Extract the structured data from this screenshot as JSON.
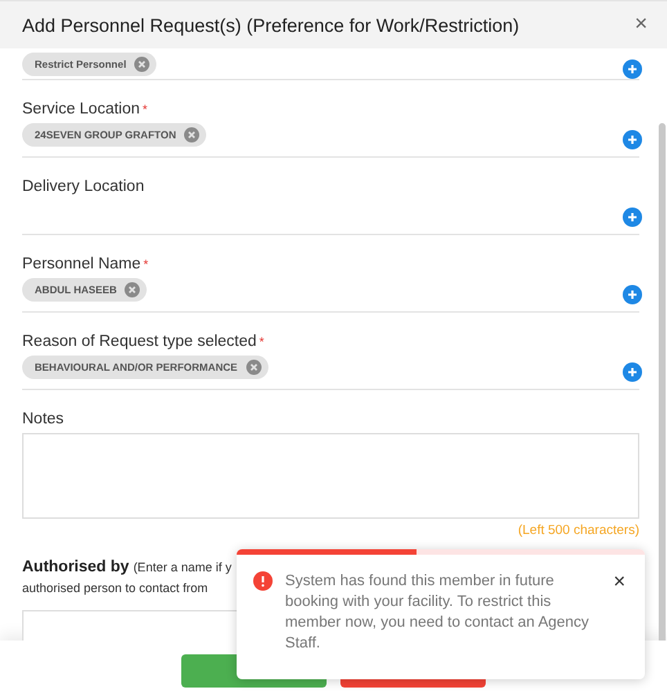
{
  "dialog": {
    "title": "Add Personnel Request(s) (Preference for Work/Restriction)",
    "close": "×"
  },
  "fields": [
    {
      "kind": "chips",
      "chips": [
        "Restrict Personnel"
      ]
    },
    {
      "kind": "chips",
      "label": "Service Location",
      "required_mark": "*",
      "chips": [
        "24SEVEN GROUP GRAFTON"
      ]
    },
    {
      "kind": "chips",
      "label": "Delivery Location"
    },
    {
      "kind": "chips",
      "label": "Personnel Name",
      "required_mark": "*",
      "chips": [
        "ABDUL HASEEB"
      ]
    },
    {
      "kind": "chips",
      "label": "Reason of Request type selected",
      "required_mark": "*",
      "chips": [
        "BEHAVIOURAL AND/OR PERFORMANCE"
      ]
    }
  ],
  "notes": {
    "label": "Notes",
    "counter": "(Left 500 characters)"
  },
  "authorised": {
    "label": "Authorised by",
    "hint_line_1": "(Enter a name if y",
    "hint_line_2": "authorised person to contact from"
  },
  "toast": {
    "kind": "error",
    "message": "System has found this member in future booking with your facility. To restrict this member now, you need to contact an Agency Staff.",
    "close": "×",
    "level": 0.44
  },
  "footer": {
    "buttons": [
      {
        "kind": "confirm"
      },
      {
        "kind": "cancel"
      }
    ]
  }
}
